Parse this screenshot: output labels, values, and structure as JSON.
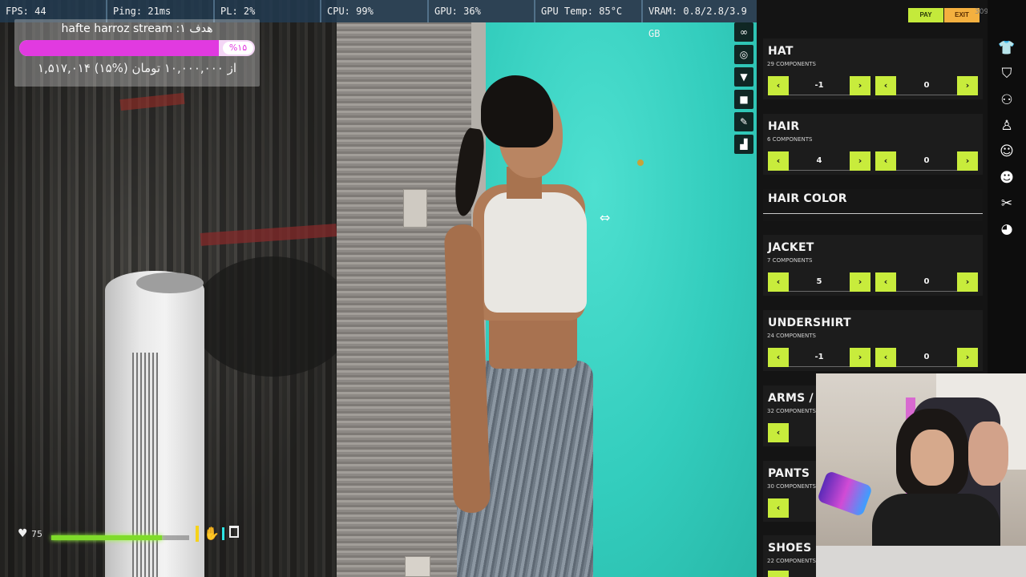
{
  "perf": [
    {
      "id": "fps",
      "text": "FPS: 44"
    },
    {
      "id": "ping",
      "text": "Ping: 21ms"
    },
    {
      "id": "pl",
      "text": "PL: 2%"
    },
    {
      "id": "cpu",
      "text": "CPU: 99%"
    },
    {
      "id": "gpu",
      "text": "GPU: 36%"
    },
    {
      "id": "gputemp",
      "text": "GPU Temp: 85°C"
    },
    {
      "id": "vram",
      "text": "VRAM: 0.8/2.8/3.9 GB"
    }
  ],
  "goal": {
    "title": "hafte harroz stream :هدف ۱",
    "percent_label": "%۱۵",
    "progress": 0.15,
    "amount": "۱,۵۱۷,۰۱۴ از ۱۰,۰۰۰,۰۰۰ تومان (%۱۵)",
    "fill_color": "#e13ae0"
  },
  "hud": {
    "health": "75",
    "health_fraction": 0.8,
    "health_icon": "heart-icon",
    "icons": [
      "hand-icon",
      "cup-icon"
    ]
  },
  "top": {
    "pay": "PAY",
    "exit": "EXIT",
    "faint": "3095)"
  },
  "quick_icons": [
    "mask-icon",
    "glasses-icon",
    "shirt-icon",
    "bag-icon",
    "brush-icon",
    "sock-icon"
  ],
  "sections": [
    {
      "key": "hat",
      "title": "HAT",
      "sub": "29 COMPONENTS",
      "a": "-1",
      "b": "0"
    },
    {
      "key": "hair",
      "title": "HAIR",
      "sub": "6 COMPONENTS",
      "a": "4",
      "b": "0"
    },
    {
      "key": "hair_color",
      "title": "HAIR COLOR"
    },
    {
      "key": "jacket",
      "title": "JACKET",
      "sub": "7 COMPONENTS",
      "a": "5",
      "b": "0"
    },
    {
      "key": "undershirt",
      "title": "UNDERSHIRT",
      "sub": "24 COMPONENTS",
      "a": "-1",
      "b": "0"
    },
    {
      "key": "arms",
      "title": "ARMS / (",
      "sub": "32 COMPONENTS"
    },
    {
      "key": "pants",
      "title": "PANTS",
      "sub": "30 COMPONENTS"
    },
    {
      "key": "shoes",
      "title": "SHOES",
      "sub": "22 COMPONENTS"
    }
  ],
  "rail_icons": [
    "tshirt-icon",
    "vest-icon",
    "people-icon",
    "person-icon",
    "smile-icon",
    "face-icon",
    "scissors-icon",
    "palette-icon"
  ],
  "colors": {
    "accent_green": "#c8ec3c",
    "exit_orange": "#f4b03f",
    "panel_bg": "#141414"
  }
}
